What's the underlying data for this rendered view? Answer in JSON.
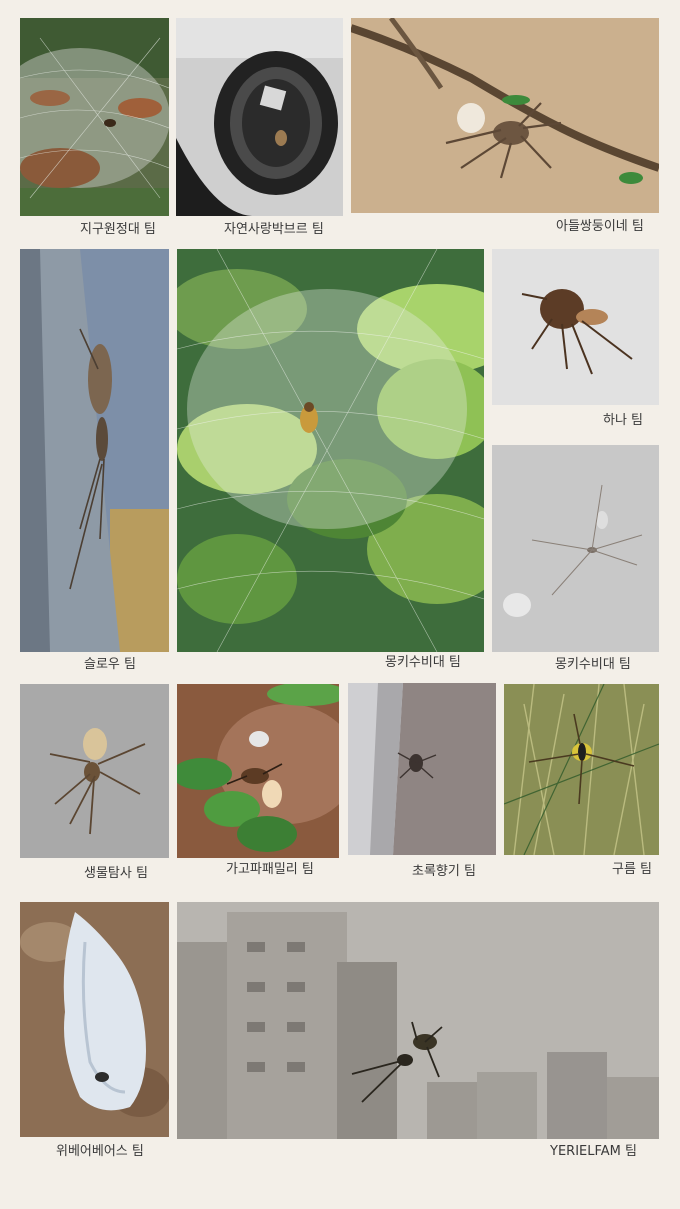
{
  "captions": {
    "p1": "지구원정대 팀",
    "p2": "자연사랑박브르 팀",
    "p3": "아들쌍둥이네 팀",
    "p4": "슬로우 팀",
    "p5": "몽키수비대 팀",
    "p6": "하나 팀",
    "p7": "몽키수비대 팀",
    "p8": "생물탐사 팀",
    "p9": "가고파패밀리 팀",
    "p10": "초록향기 팀",
    "p11": "구름 팀",
    "p12": "위베어베어스 팀",
    "p13": "YERIELFAM 팀"
  },
  "colors": {
    "background": "#f3efe8",
    "caption_text": "#3a3a3a"
  }
}
